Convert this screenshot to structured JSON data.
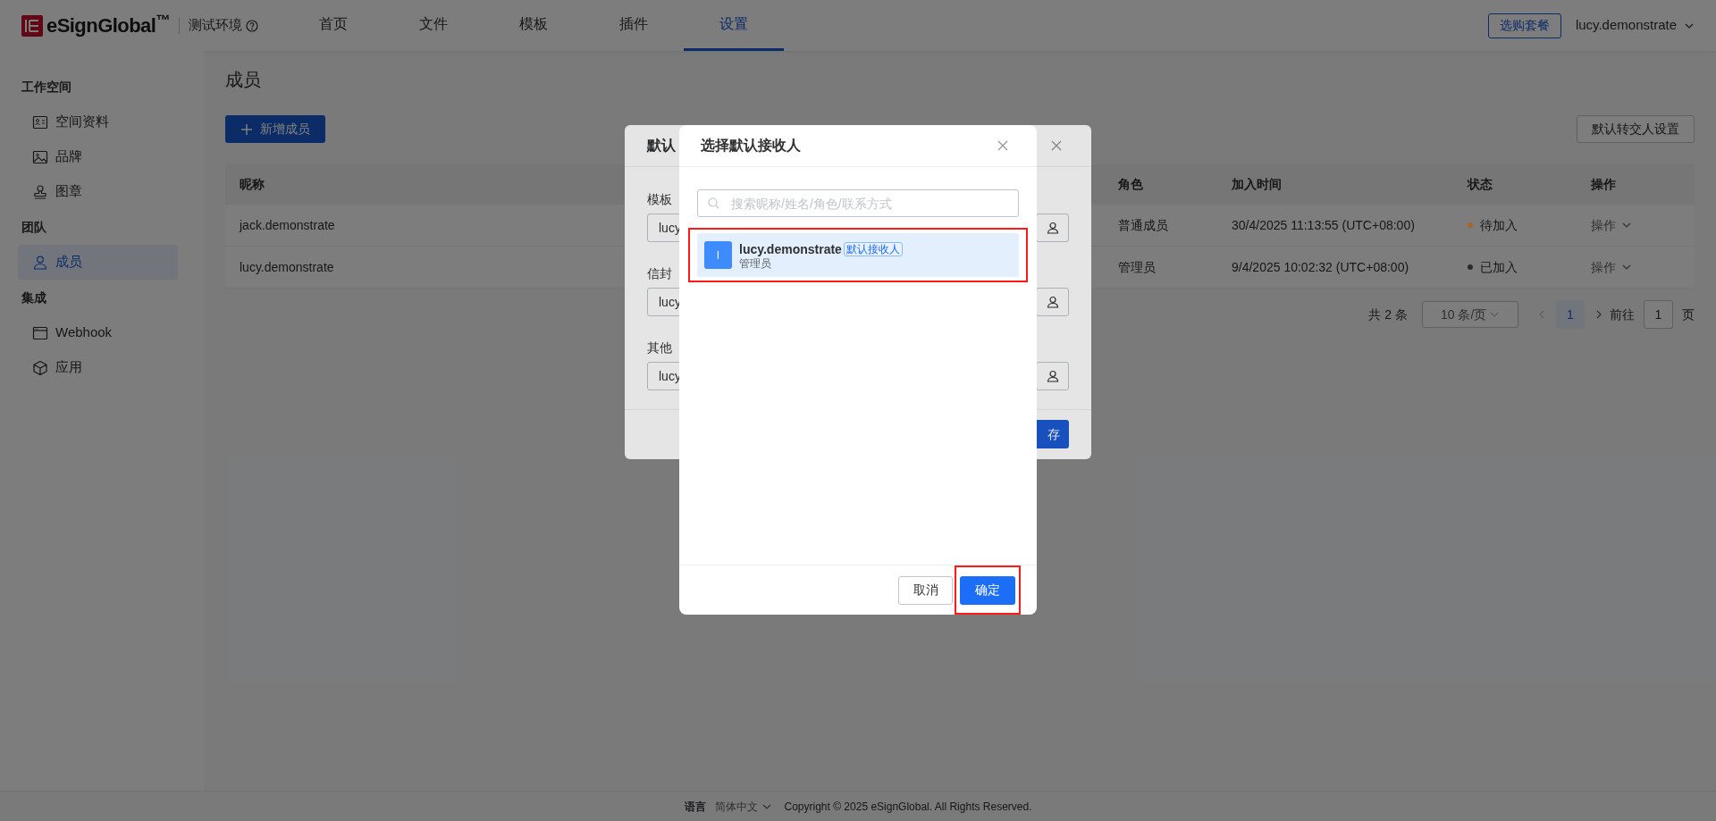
{
  "header": {
    "logo": "eSignGlobal$^{™}$",
    "environment": "测试环境",
    "nav": [
      {
        "label": "首页",
        "selected": false
      },
      {
        "label": "文件",
        "selected": false
      },
      {
        "label": "模板",
        "selected": false
      },
      {
        "label": "插件",
        "selected": false
      },
      {
        "label": "设置",
        "selected": true
      }
    ],
    "plan_button": "选购套餐",
    "user": "lucy.demonstrate"
  },
  "sidebar": {
    "sections": [
      {
        "title": "工作空间",
        "items": [
          {
            "label": "空间资料",
            "kind": "card",
            "selected": false
          },
          {
            "label": "品牌",
            "kind": "image",
            "selected": false
          },
          {
            "label": "图章",
            "kind": "stamp",
            "selected": false
          }
        ]
      },
      {
        "title": "团队",
        "items": [
          {
            "label": "成员",
            "kind": "user",
            "selected": true
          }
        ]
      },
      {
        "title": "集成",
        "items": [
          {
            "label": "Webhook",
            "kind": "window",
            "selected": false
          },
          {
            "label": "应用",
            "kind": "cube",
            "selected": false
          }
        ]
      }
    ]
  },
  "page": {
    "title": "成员",
    "add_button": "新增成员",
    "transfer_button": "默认转交人设置"
  },
  "table": {
    "columns": [
      "昵称",
      "角色",
      "加入时间",
      "状态",
      "操作"
    ],
    "rows": [
      {
        "nickname": "jack.demonstrate",
        "role": "普通成员",
        "joined": "30/4/2025 11:13:55 (UTC+08:00)",
        "status": "待加入",
        "color": "#a8652c",
        "action": "操作"
      },
      {
        "nickname": "lucy.demonstrate",
        "role": "管理员",
        "joined": "9/4/2025 10:02:32 (UTC+08:00)",
        "status": "已加入",
        "color": "#2b2b2b",
        "action": "操作"
      }
    ]
  },
  "pagination": {
    "total": "共 2 条",
    "page_size": "10 条/页",
    "pages": [
      {
        "label": "1",
        "selected": true
      }
    ],
    "goto_label": "前往",
    "goto_value": "1",
    "goto_suffix": "页"
  },
  "back_dialog": {
    "title": "默认",
    "fields": [
      {
        "label": "模板",
        "value": "lucy"
      },
      {
        "label": "信封",
        "value": "lucy"
      },
      {
        "label": "其他",
        "value": "lucy"
      }
    ],
    "save_button": "存"
  },
  "modal": {
    "title": "选择默认接收人",
    "search": {
      "placeholder": "搜索昵称/姓名/角色/联系方式"
    },
    "options": [
      {
        "avatar": "l",
        "name": "lucy.demonstrate",
        "tag": "默认接收人",
        "role": "管理员",
        "selected": true,
        "highlighted": true
      }
    ],
    "cancel_button": "取消",
    "confirm_button": "确定",
    "confirm_highlighted": true
  },
  "footer": {
    "language_label": "语言",
    "language": "简体中文",
    "copyright": "Copyright © 2025 eSignGlobal. All Rights Reserved."
  }
}
